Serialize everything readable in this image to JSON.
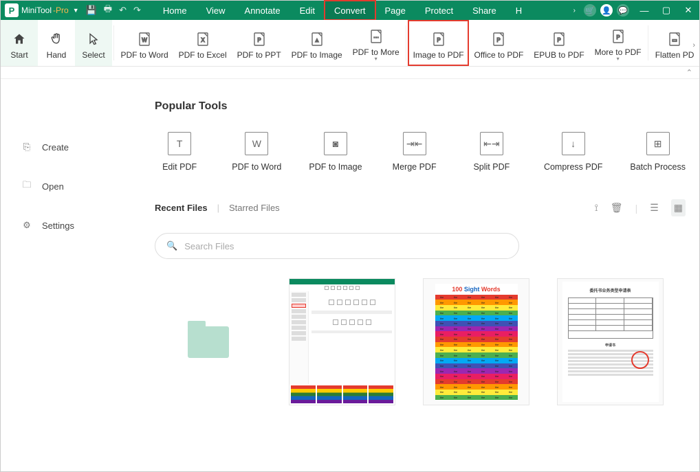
{
  "title": {
    "base": "MiniTool",
    "suffix": "-Pro"
  },
  "menu_tabs": [
    "Home",
    "View",
    "Annotate",
    "Edit",
    "Convert",
    "Page",
    "Protect",
    "Share",
    "H"
  ],
  "active_tab": "Convert",
  "ribbon": [
    {
      "label": "Start",
      "icon": "home",
      "cls": "start"
    },
    {
      "label": "Hand",
      "icon": "hand"
    },
    {
      "label": "Select",
      "icon": "cursor",
      "cls": "select"
    },
    {
      "sep": true
    },
    {
      "label": "PDF to Word",
      "icon": "w"
    },
    {
      "label": "PDF to Excel",
      "icon": "x"
    },
    {
      "label": "PDF to PPT",
      "icon": "p"
    },
    {
      "label": "PDF to Image",
      "icon": "img"
    },
    {
      "label": "PDF to More",
      "icon": "more",
      "dd": true
    },
    {
      "sep": true
    },
    {
      "label": "Image to PDF",
      "icon": "imgpdf",
      "cls": "highlight"
    },
    {
      "label": "Office to PDF",
      "icon": "office"
    },
    {
      "label": "EPUB to PDF",
      "icon": "epub"
    },
    {
      "label": "More to PDF",
      "icon": "morepdf",
      "dd": true
    },
    {
      "sep": true
    },
    {
      "label": "Flatten PD",
      "icon": "flatten"
    }
  ],
  "sidebar": [
    {
      "label": "Create",
      "icon": "create"
    },
    {
      "label": "Open",
      "icon": "open"
    },
    {
      "label": "Settings",
      "icon": "settings"
    }
  ],
  "popular_title": "Popular Tools",
  "popular": [
    {
      "label": "Edit PDF",
      "icon": "T"
    },
    {
      "label": "PDF to Word",
      "icon": "W"
    },
    {
      "label": "PDF to Image",
      "icon": "◙"
    },
    {
      "label": "Merge PDF",
      "icon": "⇥⇤"
    },
    {
      "label": "Split PDF",
      "icon": "⇤⇥"
    },
    {
      "label": "Compress PDF",
      "icon": "↓"
    },
    {
      "label": "Batch Process",
      "icon": "⊞"
    }
  ],
  "recent": {
    "tab1": "Recent Files",
    "tab2": "Starred Files"
  },
  "search_placeholder": "Search Files",
  "sight_title": {
    "a": "100 ",
    "b": "Sight ",
    "c": "Words"
  },
  "doc_title": "委托书业务类型申请表"
}
